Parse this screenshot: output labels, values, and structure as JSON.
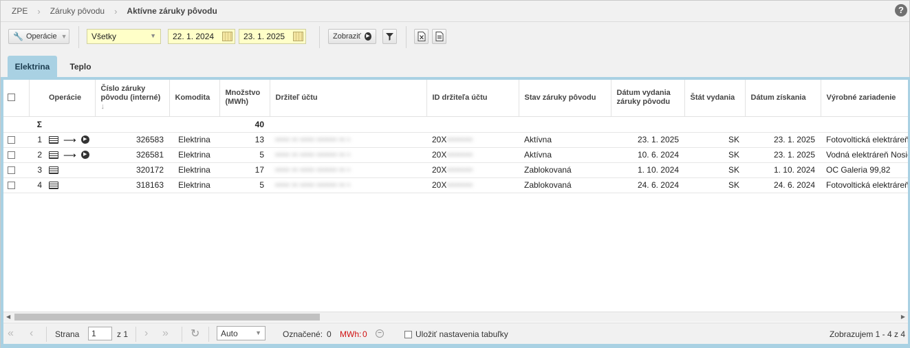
{
  "breadcrumb": {
    "items": [
      "ZPE",
      "Záruky pôvodu"
    ],
    "current": "Aktívne záruky pôvodu",
    "help": "?"
  },
  "toolbar": {
    "operations_label": "Operácie",
    "scope_selected": "Všetky",
    "date_from": "22. 1. 2024",
    "date_to": "23. 1. 2025",
    "show_label": "Zobraziť"
  },
  "tabs": [
    {
      "label": "Elektrina",
      "active": true
    },
    {
      "label": "Teplo",
      "active": false
    }
  ],
  "table": {
    "headers": {
      "operations": "Operácie",
      "number": "Číslo záruky pôvodu (interné)",
      "sort_marker": "↓",
      "commodity": "Komodita",
      "amount": "Množstvo (MWh)",
      "holder": "Držiteľ účtu",
      "holder_id": "ID držiteľa účtu",
      "status": "Stav záruky pôvodu",
      "issue_date": "Dátum vydania záruky pôvodu",
      "issue_country": "Štát vydania",
      "acquired_date": "Dátum získania",
      "device": "Výrobné zariadenie"
    },
    "sum": {
      "symbol": "Σ",
      "amount": "40"
    },
    "rows": [
      {
        "idx": "1",
        "number": "326583",
        "commodity": "Elektrina",
        "amount": "13",
        "holder": "••••• •• ••••• ••••••• •• •",
        "holder_id": "20X",
        "holder_id_blur": "•••••••••",
        "status": "Aktívna",
        "issue_date": "23. 1. 2025",
        "country": "SK",
        "acquired": "23. 1. 2025",
        "device": "Fotovoltická elektráreň G"
      },
      {
        "idx": "2",
        "number": "326581",
        "commodity": "Elektrina",
        "amount": "5",
        "holder": "••••• •• ••••• ••••••• •• •",
        "holder_id": "20X",
        "holder_id_blur": "•••••••••",
        "status": "Aktívna",
        "issue_date": "10. 6. 2024",
        "country": "SK",
        "acquired": "23. 1. 2025",
        "device": "Vodná elektráreň Nosice"
      },
      {
        "idx": "3",
        "number": "320172",
        "commodity": "Elektrina",
        "amount": "17",
        "holder": "••••• •• ••••• ••••••• •• •",
        "holder_id": "20X",
        "holder_id_blur": "•••••••••",
        "status": "Zablokovaná",
        "issue_date": "1. 10. 2024",
        "country": "SK",
        "acquired": "1. 10. 2024",
        "device": "OC Galeria 99,82"
      },
      {
        "idx": "4",
        "number": "318163",
        "commodity": "Elektrina",
        "amount": "5",
        "holder": "••••• •• ••••• ••••••• •• •",
        "holder_id": "20X",
        "holder_id_blur": "•••••••••",
        "status": "Zablokovaná",
        "issue_date": "24. 6. 2024",
        "country": "SK",
        "acquired": "24. 6. 2024",
        "device": "Fotovoltická elektráreň G"
      }
    ]
  },
  "pager": {
    "page_label": "Strana",
    "page_value": "1",
    "of_label": "z 1",
    "page_size": "Auto",
    "selected_label": "Označené:",
    "selected_count": "0",
    "mwh_label": "MWh:",
    "mwh_value": "0",
    "save_label": "Uložiť nastavenia tabuľky",
    "showing": "Zobrazujem 1 - 4 z 4"
  },
  "colors": {
    "accent_tab": "#a9d1e3",
    "filter_yellow": "#ffffc8",
    "mwh_red": "#d01010"
  }
}
